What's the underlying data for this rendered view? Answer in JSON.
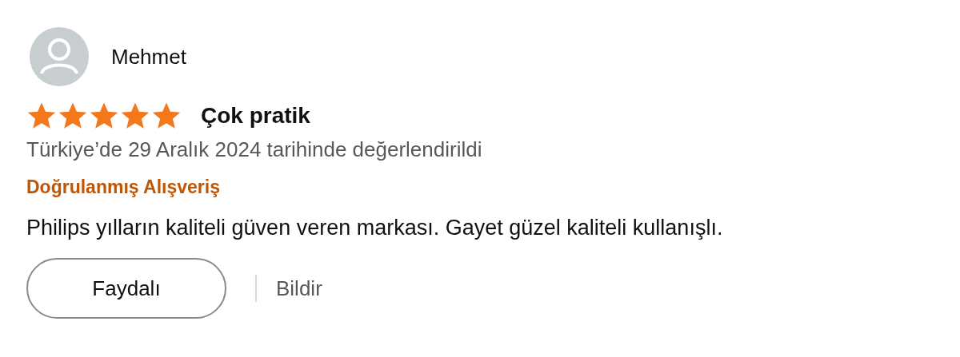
{
  "review": {
    "reviewer": "Mehmet",
    "stars": 5,
    "title": "Çok pratik",
    "date": "Türkiye’de 29 Aralık 2024 tarihinde değerlendirildi",
    "badge": "Doğrulanmış Alışveriş",
    "body": "Philips yılların kaliteli güven veren markası. Gayet güzel kaliteli kullanışlı.",
    "helpful_button": "Faydalı",
    "report_link": "Bildir"
  }
}
